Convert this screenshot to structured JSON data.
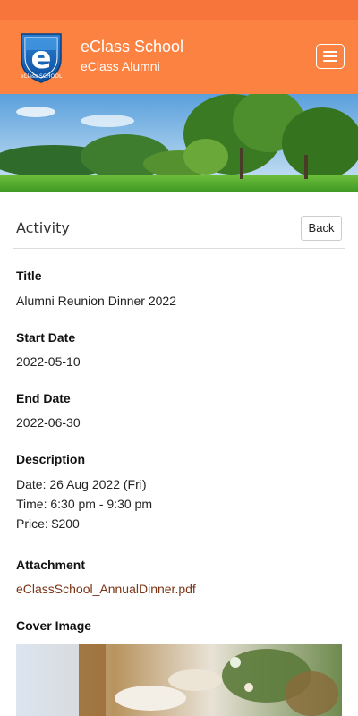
{
  "header": {
    "school_name": "eClass School",
    "site_name": "eClass Alumni",
    "logo_letter": "e",
    "logo_ring_text": "eClass SCHOOL",
    "menu_icon": "hamburger-menu-icon"
  },
  "colors": {
    "header_orange": "#fb8241",
    "status_orange": "#f7743a",
    "link": "#7a3314"
  },
  "page": {
    "section_title": "Activity",
    "back_label": "Back"
  },
  "fields": {
    "title_label": "Title",
    "title_value": "Alumni Reunion Dinner 2022",
    "start_label": "Start Date",
    "start_value": "2022-05-10",
    "end_label": "End Date",
    "end_value": "2022-06-30",
    "description_label": "Description",
    "description_lines": [
      "Date: 26 Aug 2022 (Fri)",
      "Time: 6:30 pm - 9:30 pm",
      "Price: $200"
    ],
    "attachment_label": "Attachment",
    "attachment_file": "eClassSchool_AnnualDinner.pdf",
    "cover_label": "Cover Image"
  }
}
